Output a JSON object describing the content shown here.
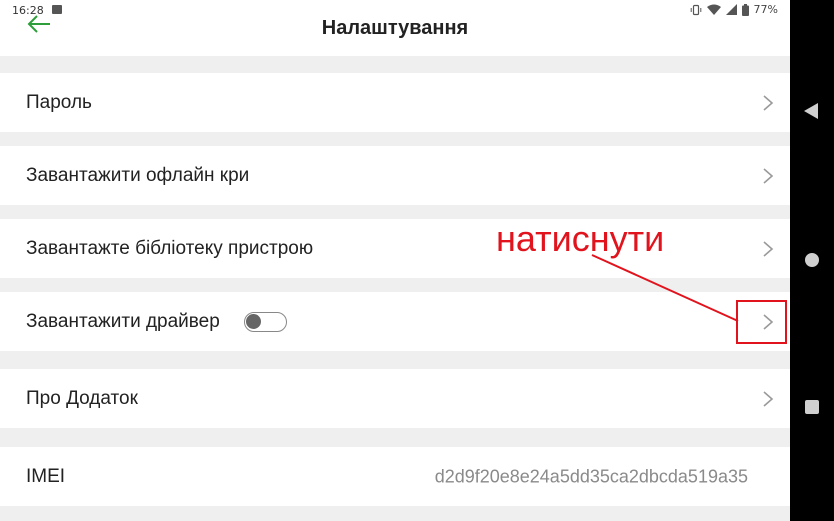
{
  "status_bar": {
    "time": "16:28",
    "battery": "77%"
  },
  "header": {
    "title": "Налаштування"
  },
  "settings": {
    "password_label": "Пароль",
    "offline_label": "Завантажити офлайн кри",
    "device_library_label": "Завантажте бібліотеку пристрою",
    "driver_label": "Завантажити драйвер",
    "driver_toggle_on": false,
    "about_label": "Про Додаток",
    "imei_label": "IMEI",
    "imei_value": "d2d9f20e8e24a5dd35ca2dbcda519a35"
  },
  "annotation": {
    "text": "натиснути",
    "color": "#e1141e"
  },
  "colors": {
    "accent_green": "#2e9e3a",
    "annotation_red": "#e1141e",
    "background": "#efefef"
  },
  "icons": [
    "back-arrow-icon",
    "chevron-right-icon",
    "vibrate-icon",
    "wifi-icon",
    "signal-icon",
    "battery-icon",
    "image-icon"
  ]
}
